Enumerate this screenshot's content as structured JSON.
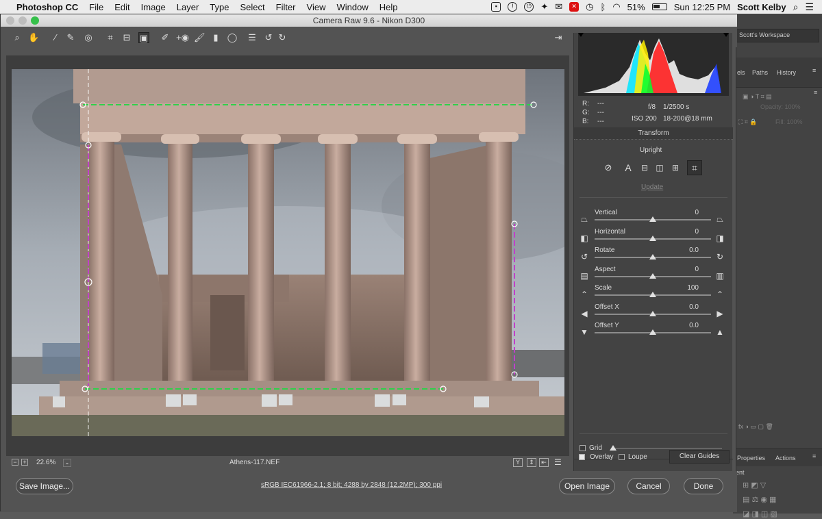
{
  "menubar": {
    "app_name": "Photoshop CC",
    "items": [
      "File",
      "Edit",
      "Image",
      "Layer",
      "Type",
      "Select",
      "Filter",
      "View",
      "Window",
      "Help"
    ],
    "battery": "51%",
    "clock": "Sun 12:25 PM",
    "user": "Scott Kelby"
  },
  "window": {
    "title": "Camera Raw 9.6  -  Nikon D300"
  },
  "ps_right": {
    "workspace": "Scott's Workspace",
    "tab_els": "els",
    "tab_paths": "Paths",
    "tab_history": "History",
    "opacity_label": "Opacity:",
    "opacity_value": "100%",
    "fill_label": "Fill:",
    "fill_value": "100%",
    "tab_properties": "Properties",
    "tab_actions": "Actions",
    "tab_ent": "ent"
  },
  "histogram": {
    "r_label": "R:",
    "g_label": "G:",
    "b_label": "B:",
    "r_value": "---",
    "g_value": "---",
    "b_value": "---",
    "aperture": "f/8",
    "shutter": "1/2500 s",
    "iso": "ISO 200",
    "lens": "18-200@18 mm"
  },
  "transform": {
    "title": "Transform",
    "upright_label": "Upright",
    "update_label": "Update",
    "sliders": [
      {
        "label": "Vertical",
        "value": "0",
        "pos": 0.5
      },
      {
        "label": "Horizontal",
        "value": "0",
        "pos": 0.5
      },
      {
        "label": "Rotate",
        "value": "0.0",
        "pos": 0.5
      },
      {
        "label": "Aspect",
        "value": "0",
        "pos": 0.5
      },
      {
        "label": "Scale",
        "value": "100",
        "pos": 0.5
      },
      {
        "label": "Offset X",
        "value": "0.0",
        "pos": 0.5
      },
      {
        "label": "Offset Y",
        "value": "0.0",
        "pos": 0.5
      }
    ],
    "grid_label": "Grid",
    "overlay_label": "Overlay",
    "loupe_label": "Loupe",
    "clear_guides_label": "Clear Guides"
  },
  "bottombar": {
    "zoom": "22.6%",
    "filename": "Athens-117.NEF"
  },
  "footer": {
    "save_image": "Save Image...",
    "workflow": "sRGB IEC61966-2.1; 8 bit; 4288 by 2848 (12.2MP); 300 ppi",
    "open_image": "Open Image",
    "cancel": "Cancel",
    "done": "Done"
  }
}
